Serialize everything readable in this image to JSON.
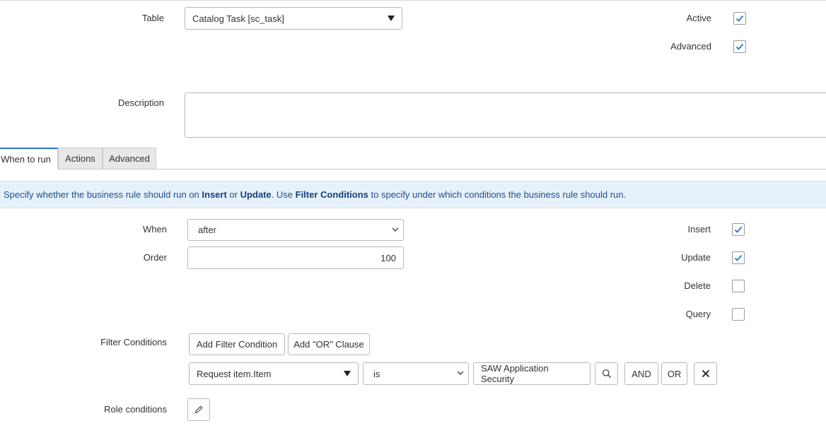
{
  "header": {
    "table_label": "Table",
    "table_value": "Catalog Task [sc_task]",
    "active_label": "Active",
    "active_checked": true,
    "advanced_label": "Advanced",
    "advanced_checked": true,
    "description_label": "Description",
    "description_value": ""
  },
  "tabs": [
    {
      "label": "When to run",
      "active": true
    },
    {
      "label": "Actions",
      "active": false
    },
    {
      "label": "Advanced",
      "active": false
    }
  ],
  "banner": {
    "t1": "Specify whether the business rule should run on ",
    "b1": "Insert",
    "t2": " or ",
    "b2": "Update",
    "t3": ". Use ",
    "b3": "Filter Conditions",
    "t4": " to specify under which conditions the business rule should run."
  },
  "when_to_run": {
    "when_label": "When",
    "when_value": "after",
    "order_label": "Order",
    "order_value": "100",
    "insert_label": "Insert",
    "insert_checked": true,
    "update_label": "Update",
    "update_checked": true,
    "delete_label": "Delete",
    "delete_checked": false,
    "query_label": "Query",
    "query_checked": false
  },
  "filter": {
    "label": "Filter Conditions",
    "add_condition": "Add Filter Condition",
    "add_or": "Add \"OR\" Clause",
    "field_value": "Request item.Item",
    "operator_value": "is",
    "value": "SAW Application Security",
    "and_label": "AND",
    "or_label": "OR"
  },
  "role": {
    "label": "Role conditions"
  }
}
